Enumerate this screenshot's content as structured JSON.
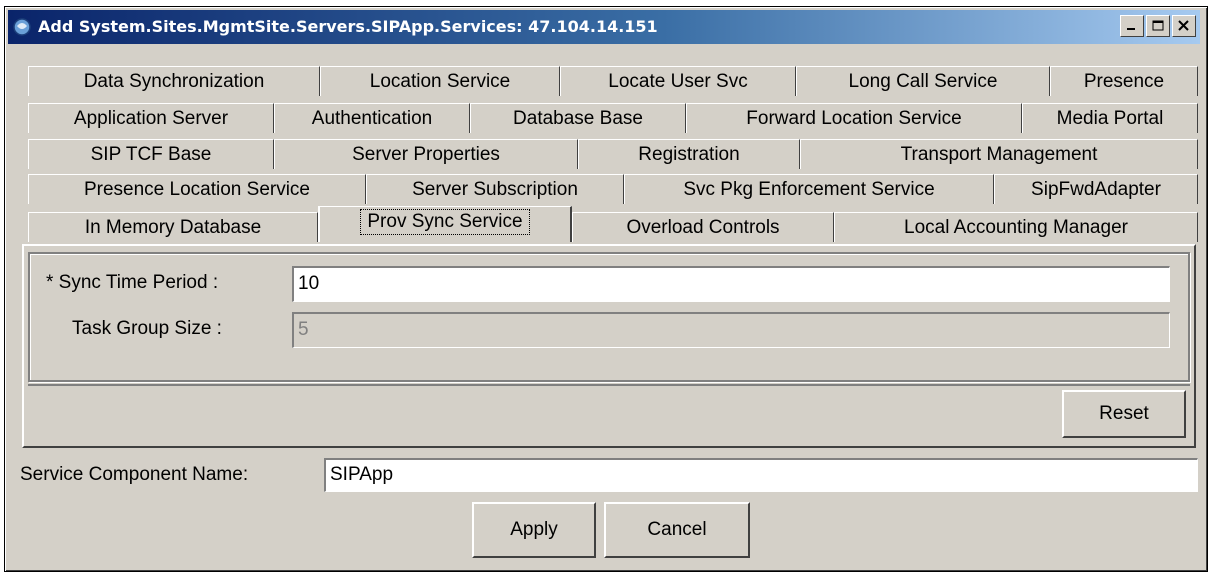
{
  "window": {
    "title": "Add System.Sites.MgmtSite.Servers.SIPApp.Services: 47.104.14.151"
  },
  "tabs": {
    "row1": [
      "Data Synchronization",
      "Location Service",
      "Locate User Svc",
      "Long Call Service",
      "Presence"
    ],
    "row2": [
      "Application Server",
      "Authentication",
      "Database Base",
      "Forward Location Service",
      "Media Portal"
    ],
    "row3": [
      "SIP TCF Base",
      "Server Properties",
      "Registration",
      "Transport Management"
    ],
    "row4": [
      "Presence Location Service",
      "Server Subscription",
      "Svc Pkg Enforcement Service",
      "SipFwdAdapter"
    ],
    "row5": [
      "In Memory Database",
      "Prov Sync Service",
      "Overload Controls",
      "Local Accounting Manager"
    ],
    "active": "Prov Sync Service"
  },
  "form": {
    "sync_time_label": "* Sync Time Period :",
    "sync_time_value": "10",
    "task_group_label": "Task Group Size :",
    "task_group_value": "5",
    "reset_label": "Reset"
  },
  "footer": {
    "component_label": "Service Component Name:",
    "component_value": "SIPApp",
    "apply_label": "Apply",
    "cancel_label": "Cancel"
  },
  "colors": {
    "title_gradient_start": "#0a246a",
    "title_gradient_end": "#a6caf0",
    "face": "#d4d0c8"
  },
  "icons": [
    "app-icon",
    "minimize-icon",
    "maximize-icon",
    "close-icon"
  ]
}
